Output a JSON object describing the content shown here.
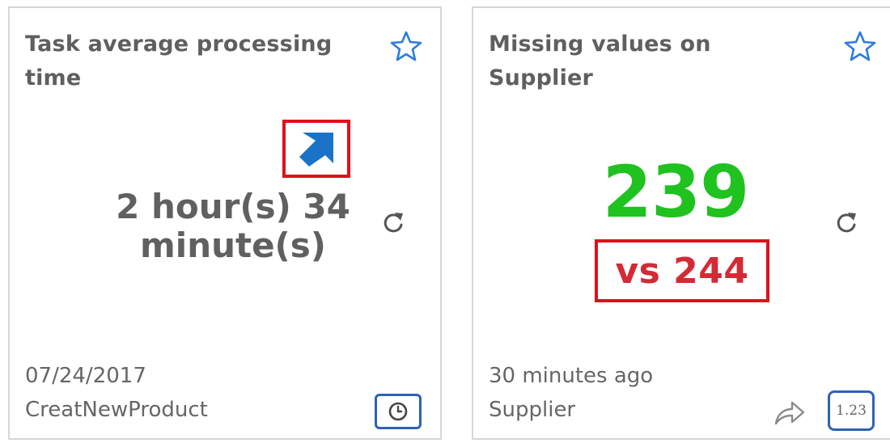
{
  "cards": [
    {
      "title": "Task average processing time",
      "trend_icon": "arrow-up-right-icon",
      "value": "2 hour(s) 34 minute(s)",
      "date": "07/24/2017",
      "source": "CreatNewProduct",
      "action_icon": "clock-icon"
    },
    {
      "title": "Missing values on Supplier",
      "value": "239",
      "comparison": "vs 244",
      "updated": "30 minutes ago",
      "source": "Supplier",
      "format_label": "1.23",
      "action_icons": [
        "share-arrow-icon",
        "number-format-icon"
      ]
    }
  ],
  "colors": {
    "title_text": "#5f5f5f",
    "value_text": "#606060",
    "kpi_green": "#1fc21f",
    "comparison_red": "#d42a35",
    "highlight_red": "#e0101b",
    "accent_blue": "#2d62b5",
    "trend_blue": "#1a73c9",
    "meta_text": "#666666",
    "border": "#d7d7d7"
  }
}
